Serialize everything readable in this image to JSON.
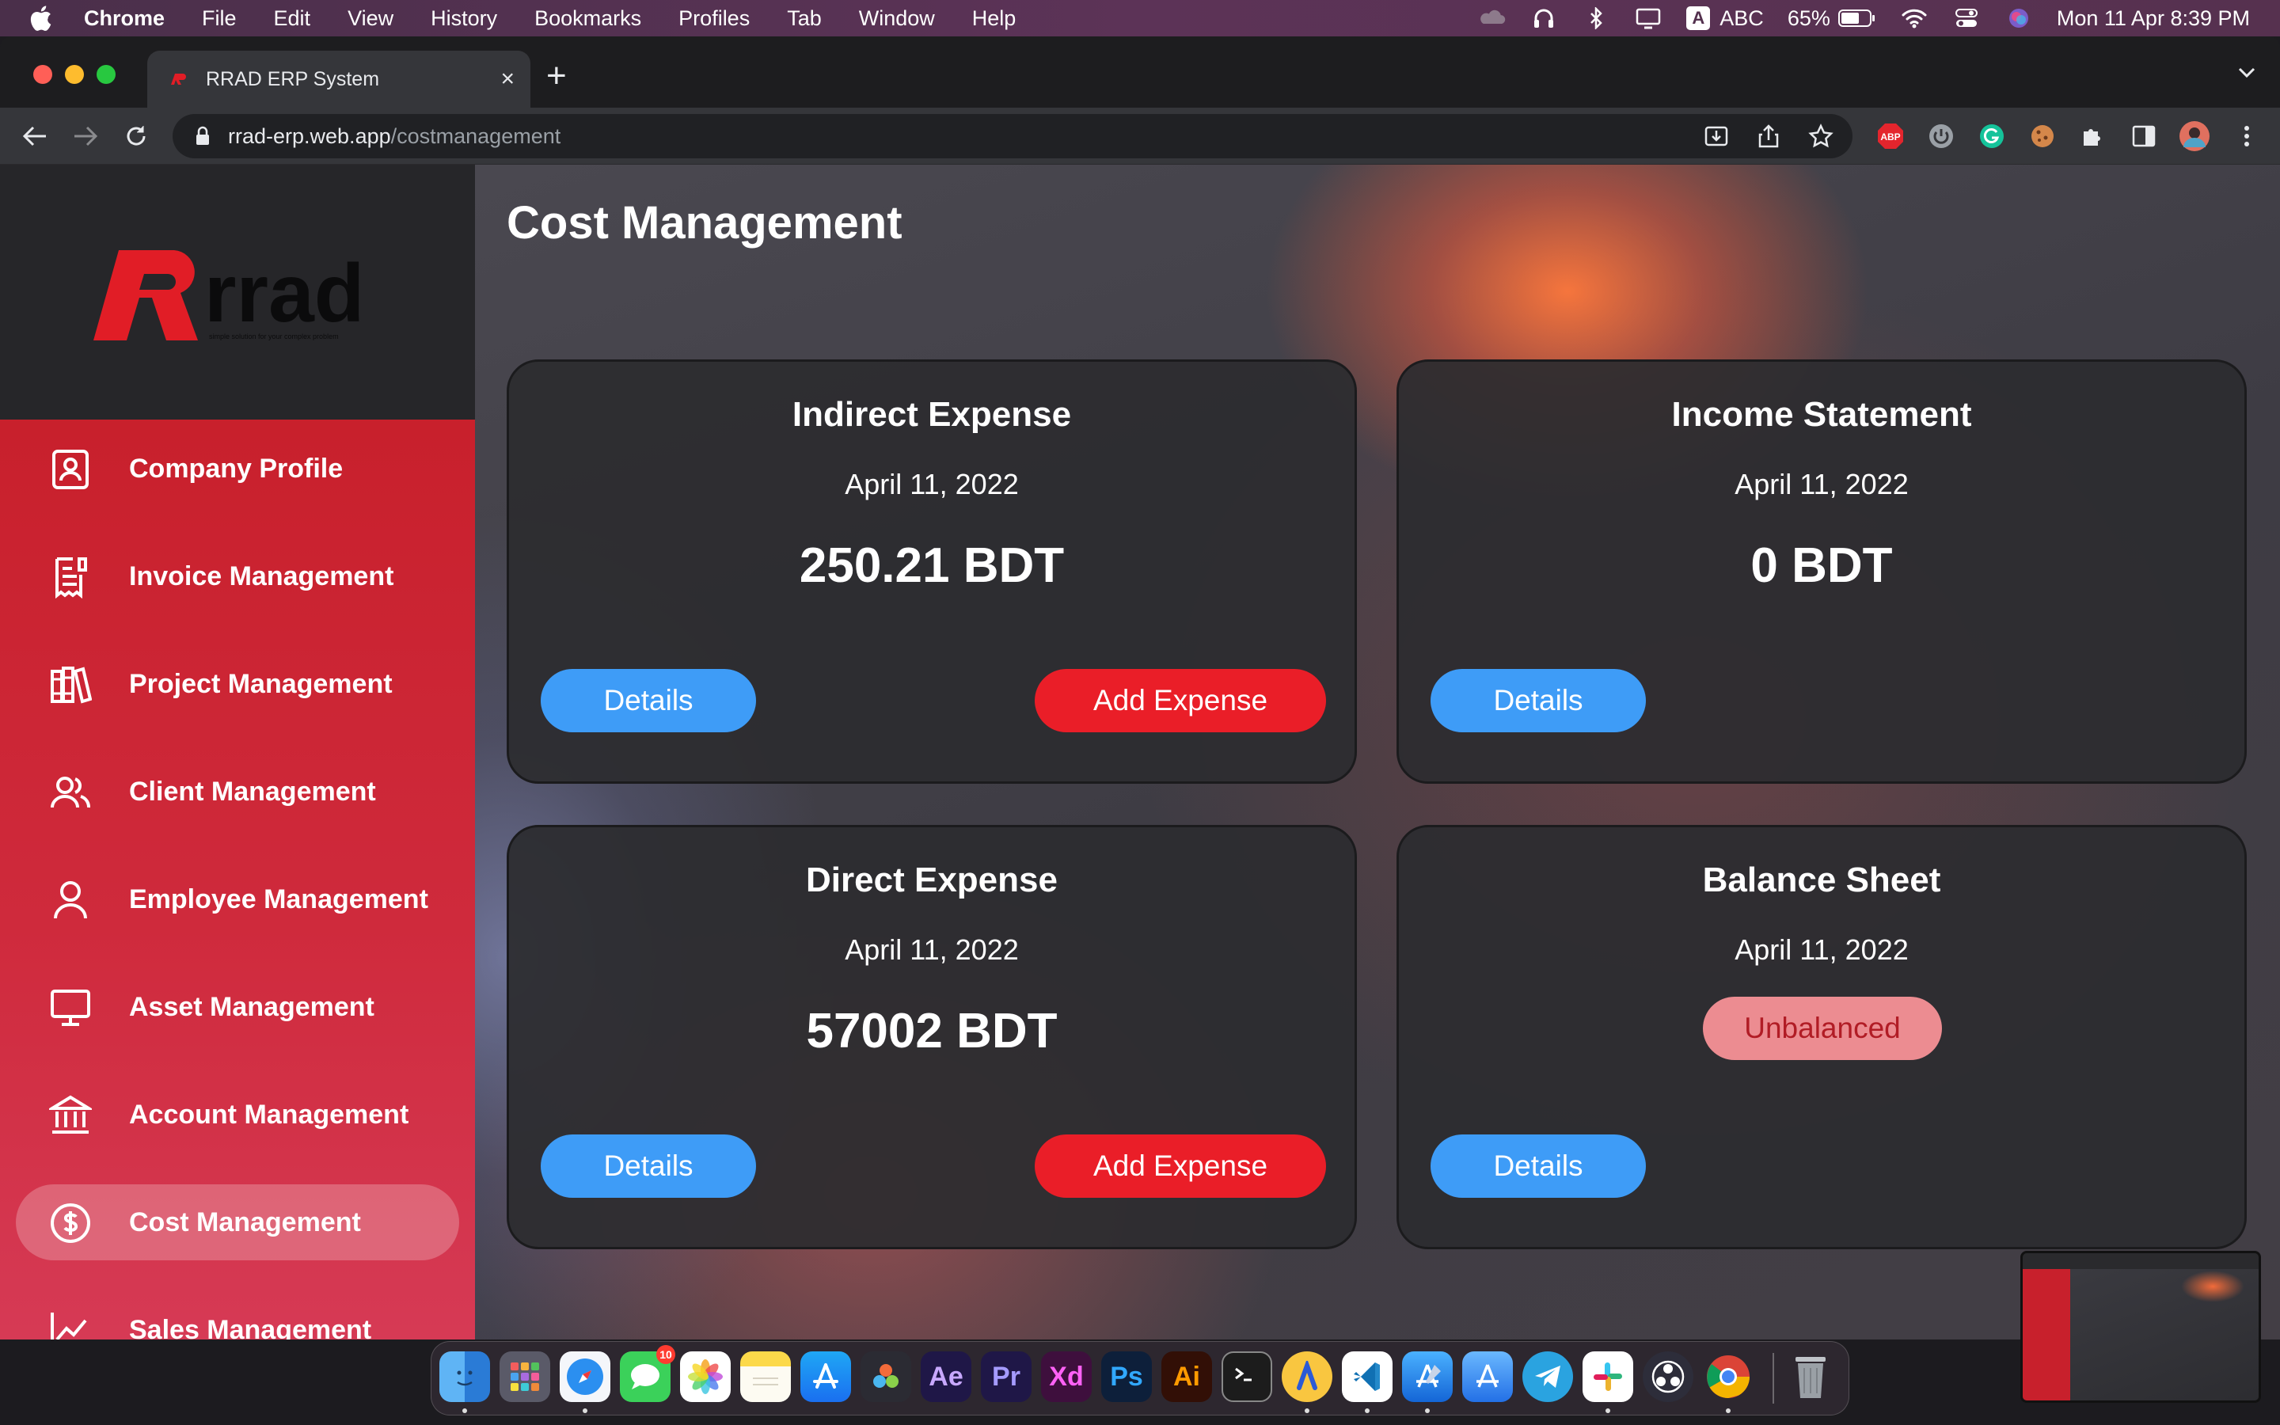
{
  "menubar": {
    "app": "Chrome",
    "items": [
      "File",
      "Edit",
      "View",
      "History",
      "Bookmarks",
      "Profiles",
      "Tab",
      "Window",
      "Help"
    ],
    "input_source": "ABC",
    "battery": "65%",
    "datetime": "Mon 11 Apr  8:39 PM"
  },
  "browser": {
    "tab_title": "RRAD ERP System",
    "url_host": "rrad-erp.web.app",
    "url_path": "/costmanagement"
  },
  "sidebar": {
    "logo_text": "rrad",
    "logo_tagline": "simple solution for your complex problem",
    "items": [
      {
        "label": "Company Profile",
        "icon": "company-profile-icon"
      },
      {
        "label": "Invoice Management",
        "icon": "invoice-icon"
      },
      {
        "label": "Project Management",
        "icon": "project-books-icon"
      },
      {
        "label": "Client Management",
        "icon": "clients-icon"
      },
      {
        "label": "Employee Management",
        "icon": "employee-icon"
      },
      {
        "label": "Asset Management",
        "icon": "monitor-icon"
      },
      {
        "label": "Account Management",
        "icon": "bank-icon"
      },
      {
        "label": "Cost Management",
        "icon": "dollar-circle-icon",
        "active": true
      },
      {
        "label": "Sales Management",
        "icon": "sales-chart-icon"
      }
    ]
  },
  "page": {
    "title": "Cost Management",
    "cards": [
      {
        "title": "Indirect Expense",
        "date": "April 11, 2022",
        "amount": "250.21 BDT",
        "details_label": "Details",
        "add_label": "Add Expense"
      },
      {
        "title": "Income Statement",
        "date": "April 11, 2022",
        "amount": "0 BDT",
        "details_label": "Details"
      },
      {
        "title": "Direct Expense",
        "date": "April 11, 2022",
        "amount": "57002 BDT",
        "details_label": "Details",
        "add_label": "Add Expense"
      },
      {
        "title": "Balance Sheet",
        "date": "April 11, 2022",
        "status": "Unbalanced",
        "details_label": "Details"
      }
    ]
  },
  "dock": {
    "messages_badge": "10",
    "apps": [
      "Finder",
      "Launchpad",
      "Safari",
      "Messages",
      "Photos",
      "Notes",
      "App Store",
      "DaVinci Resolve",
      "After Effects",
      "Premiere Pro",
      "Adobe XD",
      "Photoshop",
      "Illustrator",
      "Terminal",
      "Arc",
      "VS Code",
      "Xcode",
      "Instruments",
      "Telegram",
      "Slack",
      "OBS",
      "Chrome",
      "Trash"
    ],
    "labels": {
      "ae": "Ae",
      "pr": "Pr",
      "xd": "Xd",
      "ps": "Ps",
      "ai": "Ai"
    }
  },
  "colors": {
    "sidebar_red": "#c8202c",
    "details_blue": "#3e9cf7",
    "add_red": "#ea1e28",
    "unbalanced_pill": "#ec8c91",
    "card_bg": "#2c2c2f"
  }
}
